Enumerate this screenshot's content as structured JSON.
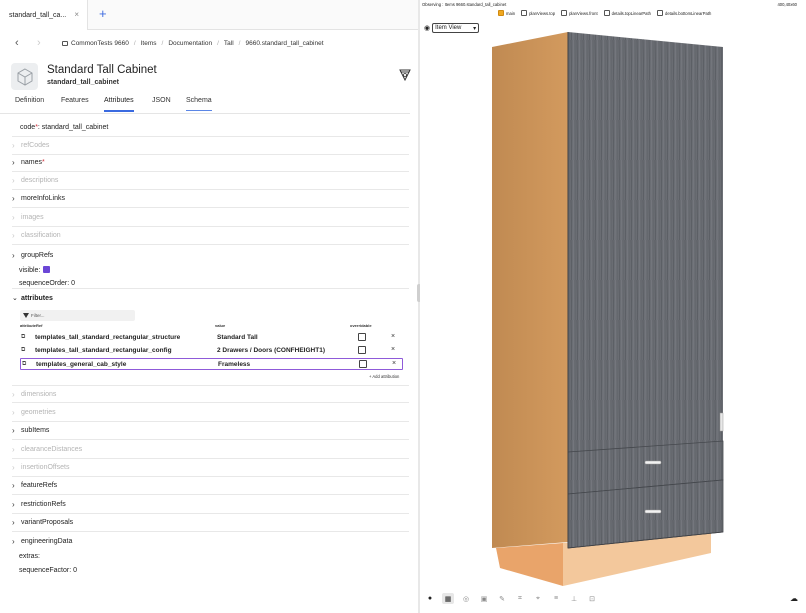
{
  "tab": {
    "title": "standard_tall_ca...",
    "close": "×",
    "new_tab": "+"
  },
  "nav": {
    "back": "‹",
    "forward": "›",
    "crumbs": [
      "CommonTests 9660",
      "Items",
      "Documentation",
      "Tall",
      "9660.standard_tall_cabinet"
    ]
  },
  "header": {
    "title": "Standard Tall Cabinet",
    "subtitle": "standard_tall_cabinet"
  },
  "subtabs": [
    "Definition",
    "Features",
    "Attributes",
    "JSON",
    "Schema"
  ],
  "fields": {
    "code_label": "code",
    "code_req": "*",
    "code_value": ": standard_tall_cabinet",
    "refCodes": "refCodes",
    "names": "names",
    "names_req": "*",
    "descriptions": "descriptions",
    "moreInfoLinks": "moreInfoLinks",
    "images": "images",
    "classification": "classification",
    "groupRefs": "groupRefs",
    "visible": "visible:",
    "sequenceOrder": "sequenceOrder:  0",
    "attributes": "attributes",
    "dimensions": "dimensions",
    "geometries": "geometries",
    "subItems": "subItems",
    "clearanceDistances": "clearanceDistances",
    "insertionOffsets": "insertionOffsets",
    "featureRefs": "featureRefs",
    "restrictionRefs": "restrictionRefs",
    "variantProposals": "variantProposals",
    "engineeringData": "engineeringData",
    "extras": "extras:",
    "sequenceFactor": "sequenceFactor:  0"
  },
  "attributes_table": {
    "filter_placeholder": "Filter...",
    "columns": [
      "attributeRef",
      "value",
      "overridable"
    ],
    "rows": [
      {
        "ref": "templates_tall_standard_rectangular_structure",
        "value": "Standard Tall",
        "overridable": false
      },
      {
        "ref": "templates_tall_standard_rectangular_config",
        "value": "2 Drawers / Doors (CONFHEIGHT1)",
        "overridable": false
      },
      {
        "ref": "templates_general_cab_style",
        "value": "Frameless",
        "overridable": false
      }
    ],
    "delete_glyph": "×",
    "add_label": "+ Add attribution"
  },
  "viewer": {
    "observing": "Observing : Items 9660.standard_tall_cabinet",
    "dims": "400,40x60",
    "layers": [
      {
        "label": "main",
        "checked": true
      },
      {
        "label": "planViews.top",
        "checked": false
      },
      {
        "label": "planViews.front",
        "checked": false
      },
      {
        "label": "details.topLinearPath",
        "checked": false
      },
      {
        "label": "details.bottomLinearPath",
        "checked": false
      }
    ],
    "view_mode": "Item View",
    "colors": {
      "door": "#6a6d73",
      "carcass": "#c98f55",
      "toekick": "#f2c49a",
      "accent": "#3a6ae0",
      "selected": "#8f5ad9",
      "visible_swatch": "#6b46d6"
    }
  }
}
